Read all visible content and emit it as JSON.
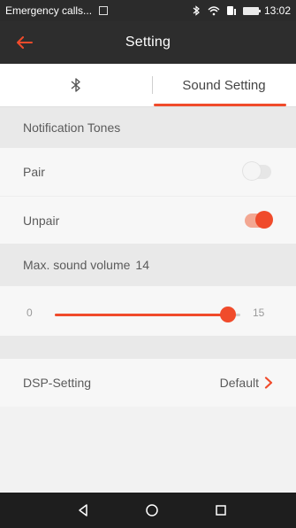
{
  "status_bar": {
    "carrier_text": "Emergency calls...",
    "time": "13:02"
  },
  "app_bar": {
    "title": "Setting",
    "accent_color": "#f04b2b"
  },
  "tabs": [
    {
      "label": "",
      "icon": "bluetooth-icon",
      "selected": false
    },
    {
      "label": "Sound Setting",
      "selected": true
    }
  ],
  "sections": {
    "notification_header": "Notification Tones",
    "pair": {
      "label": "Pair",
      "enabled": false
    },
    "unpair": {
      "label": "Unpair",
      "enabled": true
    },
    "max_volume": {
      "label": "Max. sound volume",
      "value": "14"
    },
    "slider": {
      "min_label": "0",
      "max_label": "15",
      "min": 0,
      "max": 15,
      "value": 14
    },
    "dsp": {
      "label": "DSP-Setting",
      "value": "Default",
      "chevron": "chevron-right-icon"
    }
  },
  "navigation_bar": {
    "buttons": [
      "back-icon",
      "home-icon",
      "recents-icon"
    ]
  }
}
